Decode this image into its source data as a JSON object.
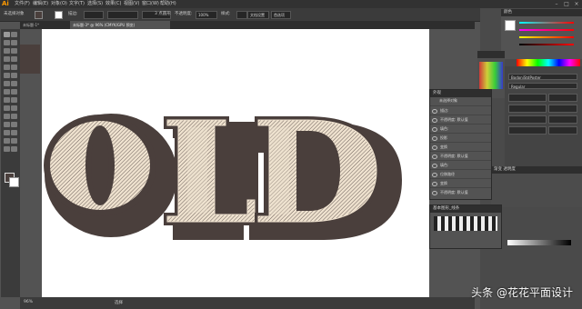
{
  "app": {
    "logo": "Ai"
  },
  "menu": [
    "文件(F)",
    "编辑(E)",
    "对象(O)",
    "文字(T)",
    "选择(S)",
    "效果(C)",
    "视图(V)",
    "窗口(W)",
    "帮助(H)"
  ],
  "control": {
    "selection_label": "未选择对象",
    "stroke_label": "描边:",
    "style_label": "3 点圆形",
    "opacity_label": "不透明度:",
    "opacity_value": "100%",
    "style2_label": "样式:",
    "doc_setup": "文档设置",
    "prefs": "首选项"
  },
  "tabs": [
    {
      "label": "未标题-1*"
    },
    {
      "label": "未标题-3* @ 96% (CMYK/GPU 预览)"
    }
  ],
  "artwork": {
    "text": "OLD"
  },
  "status": {
    "zoom": "96%",
    "tool": "选择"
  },
  "panels": {
    "appearance_title": "外观",
    "appearance_header": "未选择对象",
    "appearance_items": [
      {
        "label": "描边:"
      },
      {
        "label": "不透明度: 默认值"
      },
      {
        "label": "填色:"
      },
      {
        "label": "投影"
      },
      {
        "label": "变换"
      },
      {
        "label": "不透明度: 默认值"
      },
      {
        "label": "填色:"
      },
      {
        "label": "位移路径"
      },
      {
        "label": "变换"
      },
      {
        "label": "不透明度: 默认值"
      }
    ],
    "font_name": "BodoniStdPoster",
    "font_style": "Regular",
    "color_title": "颜色",
    "swatch_lib_title": "基本图形_线条",
    "transparency_title": "渐变 透明度"
  },
  "watermark": "头条 @花花平面设计",
  "colors": {
    "brown": "#4a3f3c",
    "cream": "#efe2cf",
    "accent": "#ff9a00"
  }
}
